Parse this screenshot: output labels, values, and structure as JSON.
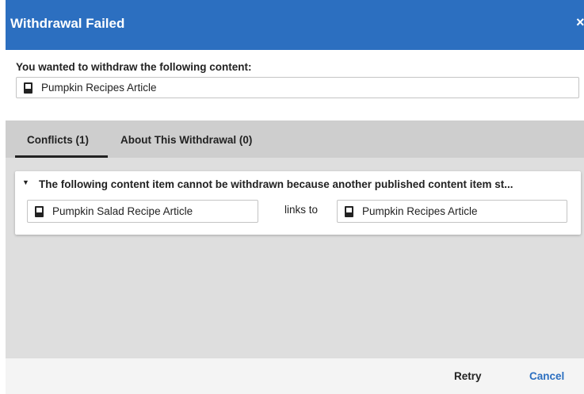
{
  "dialog": {
    "title": "Withdrawal Failed",
    "close_label": "×"
  },
  "prompt": "You wanted to withdraw the following content:",
  "content_item": "Pumpkin Recipes Article",
  "tabs": [
    {
      "label": "Conflicts (1)",
      "selected": true
    },
    {
      "label": "About This Withdrawal (0)",
      "selected": false
    }
  ],
  "conflict": {
    "caret": "▼",
    "message": "The following content item cannot be withdrawn because another published content item st...",
    "source": "Pumpkin Salad Recipe Article",
    "relation": "links to",
    "target": "Pumpkin Recipes Article"
  },
  "footer": {
    "retry_label": "Retry",
    "cancel_label": "Cancel"
  },
  "colors": {
    "accent": "#2c6fc0",
    "panel": "#dedede",
    "tab_bar": "#cecece"
  },
  "icons": {
    "document": "document-icon",
    "close": "close-icon",
    "caret": "caret-down-icon"
  }
}
